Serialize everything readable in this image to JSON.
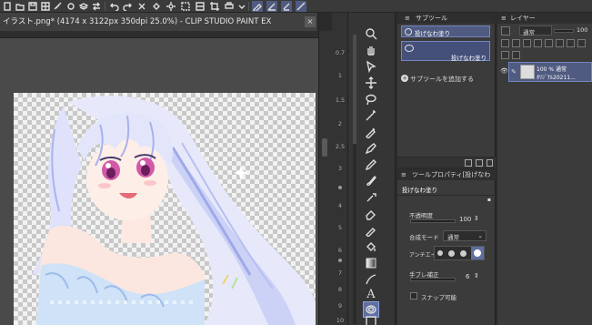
{
  "app": {
    "title": "イラスト.png* (4174 x 3122px 350dpi 25.0%)  - CLIP STUDIO PAINT EX",
    "close_label": "×"
  },
  "toolbar": {
    "icons": [
      "new-file-icon",
      "open-icon",
      "save-icon",
      "undo-icon",
      "redo-icon",
      "selection-icon",
      "transform-icon",
      "grid-icon",
      "ruler-icon",
      "pen-icon"
    ]
  },
  "ruler": {
    "numbers": [
      "0.7",
      "1",
      "1.5",
      "2",
      "2.5",
      "3",
      "4",
      "5",
      "6",
      "7",
      "8",
      "9",
      "10"
    ]
  },
  "tools": {
    "text_tool_label": "A"
  },
  "subtool": {
    "panel_title": "サブツール",
    "group_label": "投げなわ塗り",
    "item_label": "投げなわ塗り",
    "add_label": "サブツールを追加する",
    "add_icon": "+"
  },
  "property": {
    "panel_title": "ツールプロパティ[投げなわ",
    "tool_name": "投げなわ塗り",
    "opacity_label": "不透明度",
    "opacity_value": "100",
    "blend_label": "合成モード",
    "blend_value": "通常",
    "antialias_label": "アンチエイ",
    "stabilization_label": "手ブレ補正",
    "stabilization_value": "6",
    "snap_label": "スナップ可能"
  },
  "layers": {
    "panel_title": "レイヤー",
    "blend_mode": "通常",
    "opacity_value": "100",
    "layer_opacity": "100 % 通常",
    "layer_name": "ｵﾘｼﾞﾅﾙ20211..."
  },
  "colors": {
    "accent": "#5f6fa0",
    "selection": "#4f5b80",
    "background": "#2b2b2b"
  }
}
